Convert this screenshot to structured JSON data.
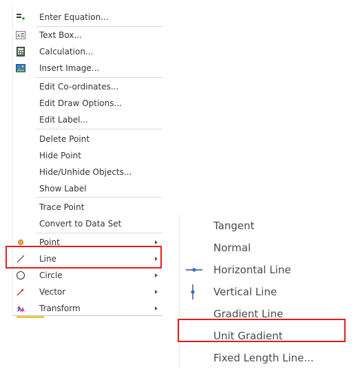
{
  "context_menu": {
    "items": [
      {
        "label": "Enter Equation...",
        "icon": "equation-plus-icon"
      },
      {
        "label": "Text Box...",
        "icon": "text-box-icon"
      },
      {
        "label": "Calculation...",
        "icon": "calculator-icon"
      },
      {
        "label": "Insert Image...",
        "icon": "image-icon"
      },
      {
        "label": "Edit Co-ordinates..."
      },
      {
        "label": "Edit Draw Options..."
      },
      {
        "label": "Edit Label..."
      },
      {
        "label": "Delete Point"
      },
      {
        "label": "Hide Point"
      },
      {
        "label": "Hide/Unhide Objects..."
      },
      {
        "label": "Show Label"
      },
      {
        "label": "Trace Point"
      },
      {
        "label": "Convert to Data Set"
      },
      {
        "label": "Point",
        "icon": "point-icon"
      },
      {
        "label": "Line",
        "icon": "line-icon"
      },
      {
        "label": "Circle",
        "icon": "circle-icon"
      },
      {
        "label": "Vector",
        "icon": "vector-icon"
      },
      {
        "label": "Transform",
        "icon": "transform-icon"
      }
    ]
  },
  "line_submenu": {
    "items": [
      {
        "label": "Tangent"
      },
      {
        "label": "Normal"
      },
      {
        "label": "Horizontal Line",
        "icon": "horizontal-line-icon"
      },
      {
        "label": "Vertical Line",
        "icon": "vertical-line-icon"
      },
      {
        "label": "Gradient Line"
      },
      {
        "label": "Unit Gradient"
      },
      {
        "label": "Fixed Length Line..."
      }
    ]
  },
  "colors": {
    "highlight": "#e51c1c",
    "menu_text": "#333333",
    "separator": "#dadada",
    "accent": "#e8c648"
  }
}
